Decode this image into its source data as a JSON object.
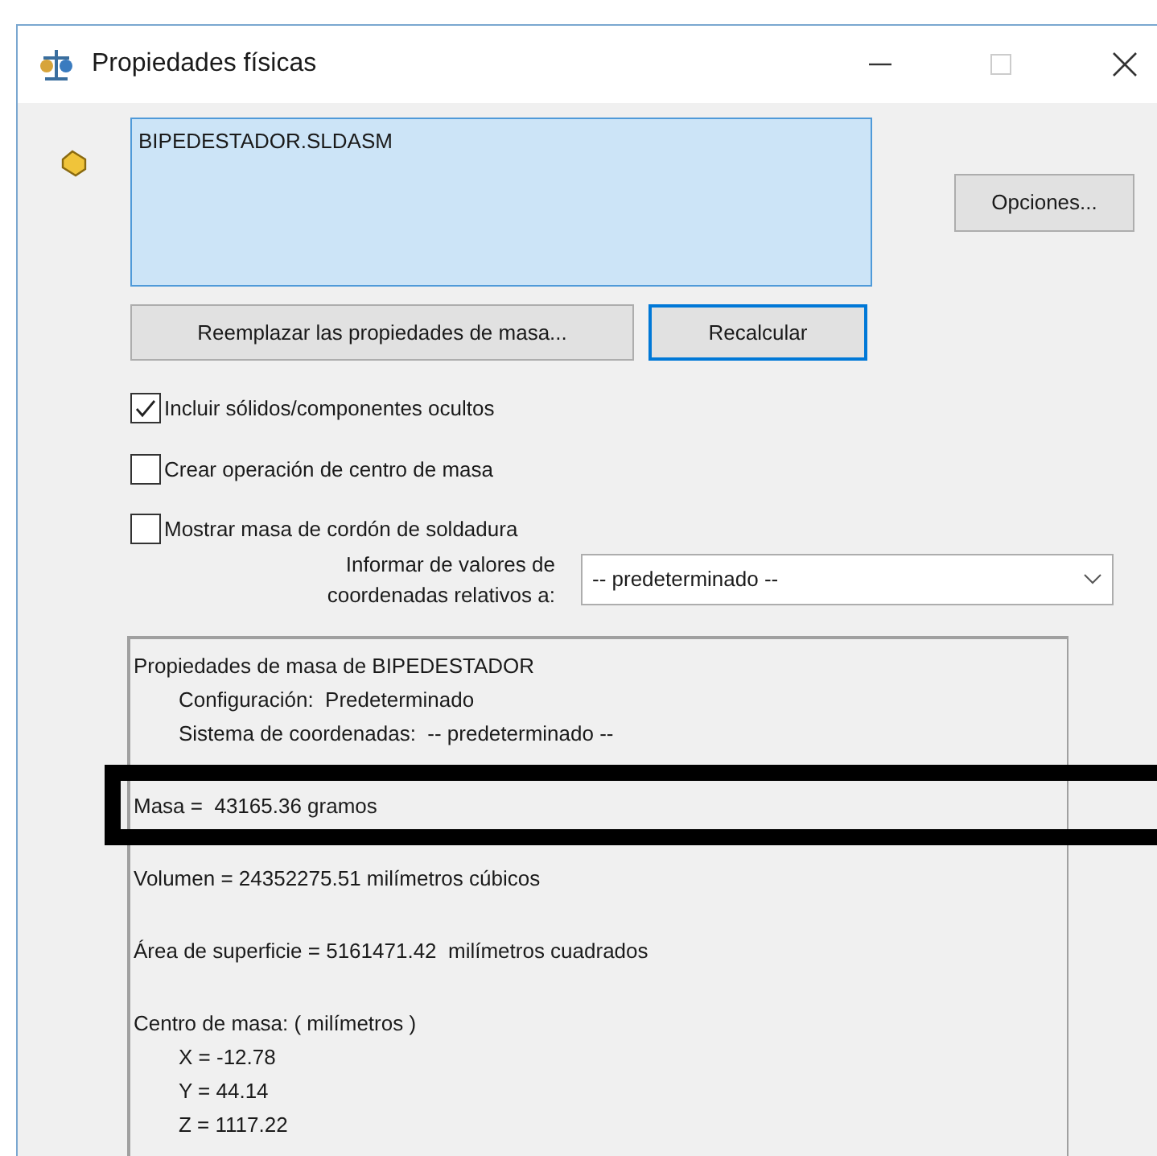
{
  "window": {
    "title": "Propiedades físicas"
  },
  "selection_list": {
    "items": [
      {
        "text": "BIPEDESTADOR.SLDASM",
        "selected": true
      }
    ]
  },
  "options_button": "Opciones...",
  "buttons": [
    "Reemplazar las propiedades de masa...",
    "Recalcular"
  ],
  "checkboxes": [
    {
      "label": "Incluir sólidos/componentes ocultos",
      "checked": true
    },
    {
      "label": "Crear operación de centro de masa",
      "checked": false
    },
    {
      "label": "Mostrar masa de cordón de soldadura",
      "checked": false
    }
  ],
  "coordinates": {
    "label": "Informar de valores de coordenadas relativos a:",
    "value": "-- predeterminado --"
  },
  "results": [
    {
      "text": "Propiedades de masa de BIPEDESTADOR",
      "highlighted": false,
      "children": [
        {
          "text": "Configuración:  Predeterminado"
        },
        {
          "text": "Sistema de coordenadas:  -- predeterminado --"
        }
      ]
    },
    {
      "text": "Masa =  43165.36 gramos",
      "highlighted": true
    },
    {
      "text": "Volumen = 24352275.51 milímetros cúbicos",
      "highlighted": false
    },
    {
      "text": "Área de superficie = 5161471.42  milímetros cuadrados",
      "highlighted": false
    },
    {
      "text": "Centro de masa: ( milímetros )",
      "highlighted": false,
      "children": [
        {
          "text": "X = -12.78"
        },
        {
          "text": "Y = 44.14"
        },
        {
          "text": "Z = 1117.22"
        }
      ]
    }
  ]
}
